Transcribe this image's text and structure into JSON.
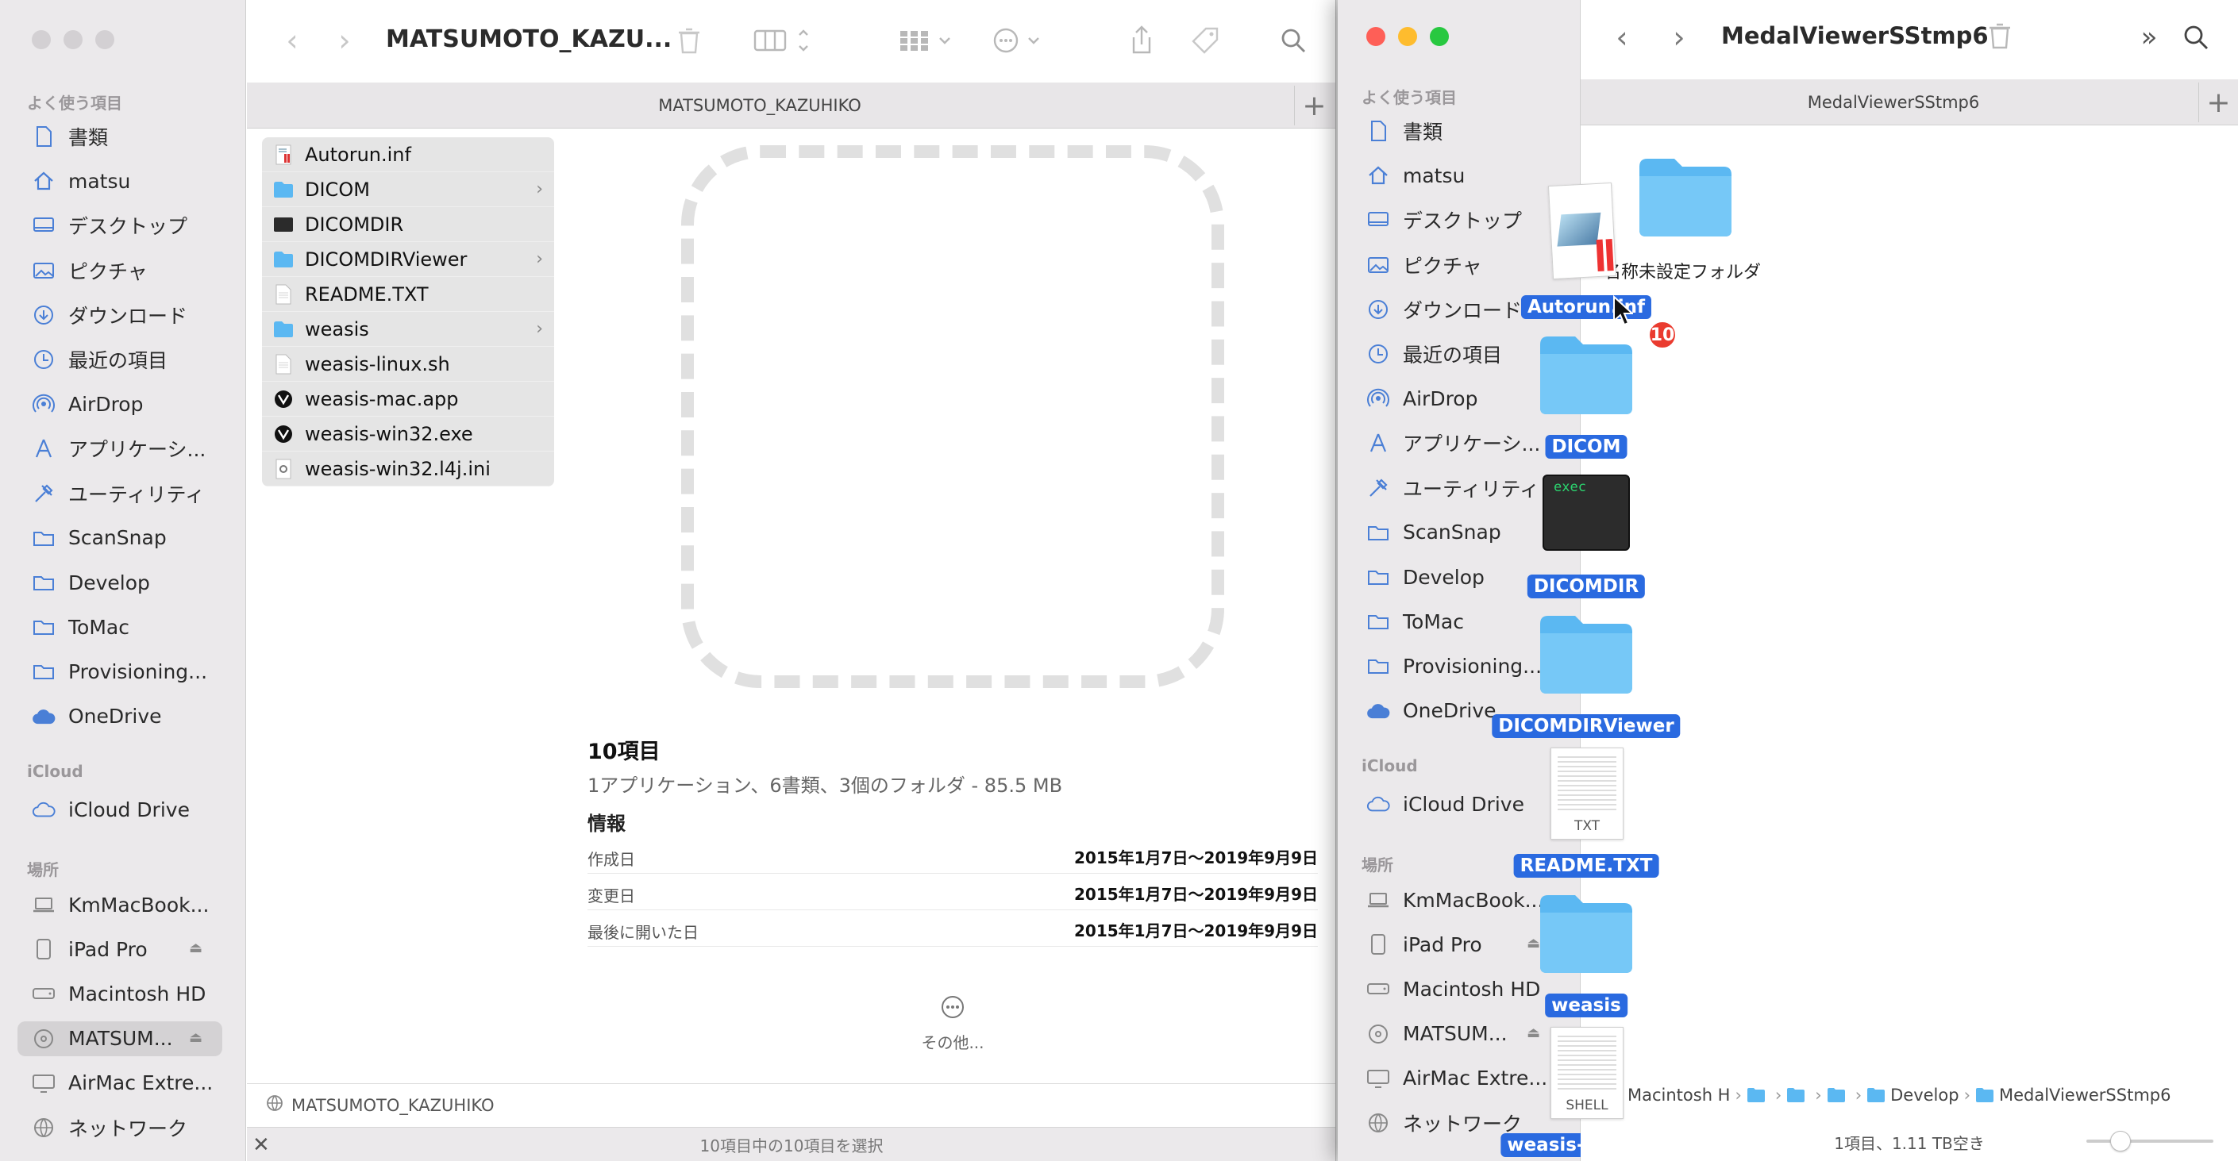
{
  "left": {
    "title": "MATSUMOTO_KAZU...",
    "tab_label": "MATSUMOTO_KAZUHIKO",
    "sidebar": {
      "favorites_header": "よく使う項目",
      "favorites": [
        "書類",
        "matsu",
        "デスクトップ",
        "ピクチャ",
        "ダウンロード",
        "最近の項目",
        "AirDrop",
        "アプリケーシ...",
        "ユーティリティ",
        "ScanSnap",
        "Develop",
        "ToMac",
        "Provisioning...",
        "OneDrive"
      ],
      "icloud_header": "iCloud",
      "icloud": [
        "iCloud Drive"
      ],
      "places_header": "場所",
      "places": [
        "KmMacBook...",
        "iPad Pro",
        "Macintosh HD",
        "MATSUM...",
        "AirMac Extre...",
        "ネットワーク"
      ]
    },
    "files": [
      {
        "name": "Autorun.inf",
        "icon": "inf-file-icon",
        "folder": false
      },
      {
        "name": "DICOM",
        "icon": "folder-icon",
        "folder": true
      },
      {
        "name": "DICOMDIR",
        "icon": "exec-icon",
        "folder": false
      },
      {
        "name": "DICOMDIRViewer",
        "icon": "folder-icon",
        "folder": true
      },
      {
        "name": "README.TXT",
        "icon": "text-file-icon",
        "folder": false
      },
      {
        "name": "weasis",
        "icon": "folder-icon",
        "folder": true
      },
      {
        "name": "weasis-linux.sh",
        "icon": "text-file-icon",
        "folder": false
      },
      {
        "name": "weasis-mac.app",
        "icon": "app-icon",
        "folder": false
      },
      {
        "name": "weasis-win32.exe",
        "icon": "app-icon",
        "folder": false
      },
      {
        "name": "weasis-win32.l4j.ini",
        "icon": "ini-file-icon",
        "folder": false
      }
    ],
    "preview": {
      "count": "10項目",
      "summary": "1アプリケーション、6書類、3個のフォルダ - 85.5 MB",
      "info_header": "情報",
      "rows": [
        {
          "key": "作成日",
          "value": "2015年1月7日〜2019年9月9日"
        },
        {
          "key": "変更日",
          "value": "2015年1月7日〜2019年9月9日"
        },
        {
          "key": "最後に開いた日",
          "value": "2015年1月7日〜2019年9月9日"
        }
      ],
      "more_label": "その他..."
    },
    "path_label": "MATSUMOTO_KAZUHIKO",
    "status": "10項目中の10項目を選択"
  },
  "right": {
    "title": "MedalViewerSStmp6",
    "tab_label": "MedalViewerSStmp6",
    "sidebar": {
      "favorites_header": "よく使う項目",
      "favorites": [
        "書類",
        "matsu",
        "デスクトップ",
        "ピクチャ",
        "ダウンロード",
        "最近の項目",
        "AirDrop",
        "アプリケーシ...",
        "ユーティリティ",
        "ScanSnap",
        "Develop",
        "ToMac",
        "Provisioning...",
        "OneDrive"
      ],
      "icloud_header": "iCloud",
      "icloud": [
        "iCloud Drive"
      ],
      "places_header": "場所",
      "places": [
        "KmMacBook...",
        "iPad Pro",
        "Macintosh HD",
        "MATSUM...",
        "AirMac Extre...",
        "ネットワーク"
      ]
    },
    "folder_label": "名称未設定フォルダ",
    "drag_items": [
      "Autorun.inf",
      "DICOM",
      "DICOMDIR",
      "DICOMDIRViewer",
      "README.TXT",
      "weasis",
      "weasis-linux.sh"
    ],
    "drag_count": "10",
    "exec_text": "exec",
    "txt_ext": "TXT",
    "shell_ext": "SHELL",
    "breadcrumbs": [
      "Macintosh H",
      "",
      "",
      "",
      "Develop",
      "MedalViewerSStmp6"
    ],
    "status": "1項目、1.11 TB空き"
  },
  "colors": {
    "accent": "#2a6ae0",
    "folder": "#5bb8f2",
    "badge": "#ea3b2f",
    "close": "#fe5f57",
    "minimize": "#febc2e",
    "zoom": "#28c840"
  }
}
